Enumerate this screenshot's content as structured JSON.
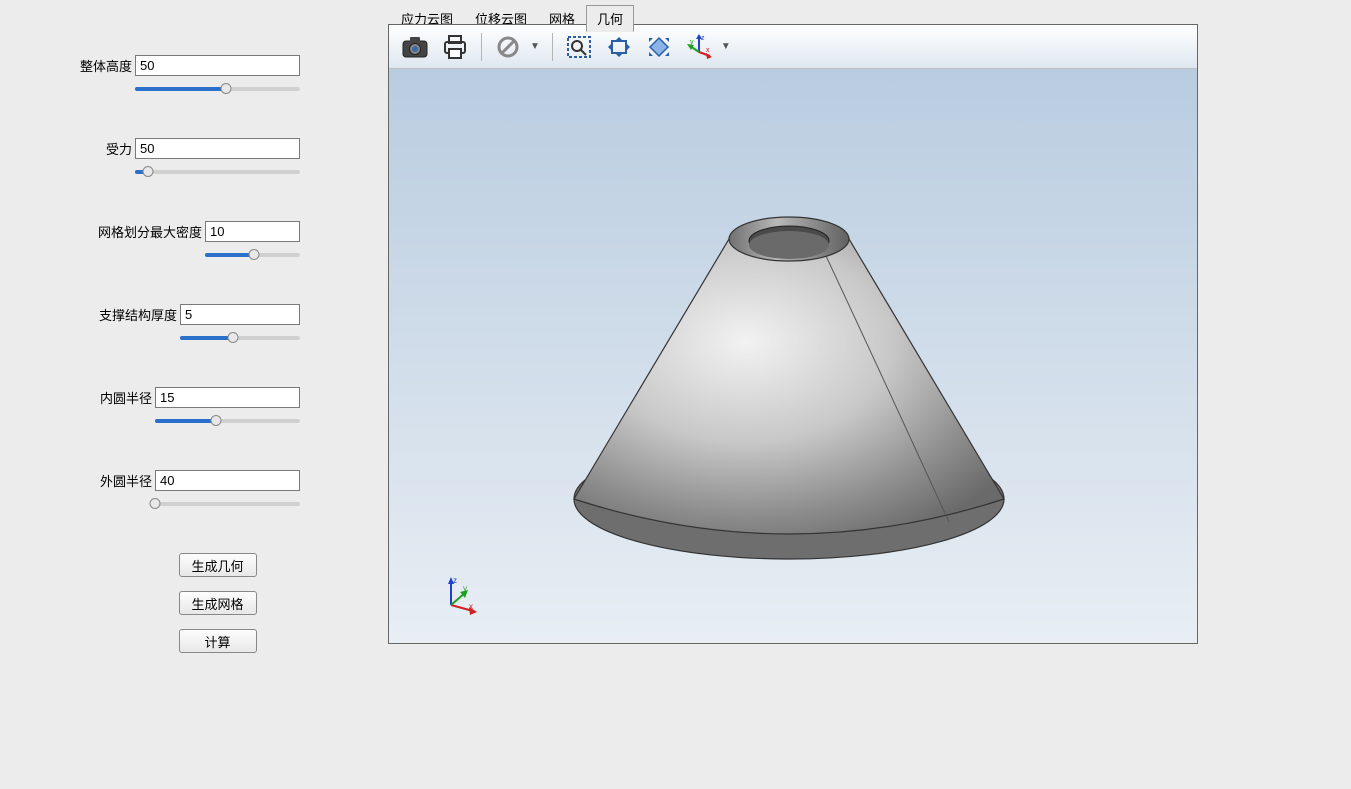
{
  "sidebar": {
    "params": [
      {
        "label": "整体高度",
        "value": "50",
        "fillPercent": 55
      },
      {
        "label": "受力",
        "value": "50",
        "fillPercent": 8
      },
      {
        "label": "网格划分最大密度",
        "value": "10",
        "fillPercent": 52
      },
      {
        "label": "支撑结构厚度",
        "value": "5",
        "fillPercent": 44
      },
      {
        "label": "内圆半径",
        "value": "15",
        "fillPercent": 42
      },
      {
        "label": "外圆半径",
        "value": "40",
        "fillPercent": 0
      }
    ],
    "buttons": {
      "generate_geometry": "生成几何",
      "generate_mesh": "生成网格",
      "compute": "计算"
    }
  },
  "tabs": {
    "items": [
      "应力云图",
      "位移云图",
      "网格",
      "几何"
    ],
    "active_index": 3
  },
  "toolbar": {
    "icons": {
      "camera": "camera-icon",
      "print": "print-icon",
      "disable": "nosign-icon",
      "zoom_window": "zoom-window-icon",
      "pan": "pan-icon",
      "fit": "fit-icon",
      "axes": "axes-icon"
    }
  },
  "triad": {
    "x": "x",
    "y": "y",
    "z": "z"
  }
}
